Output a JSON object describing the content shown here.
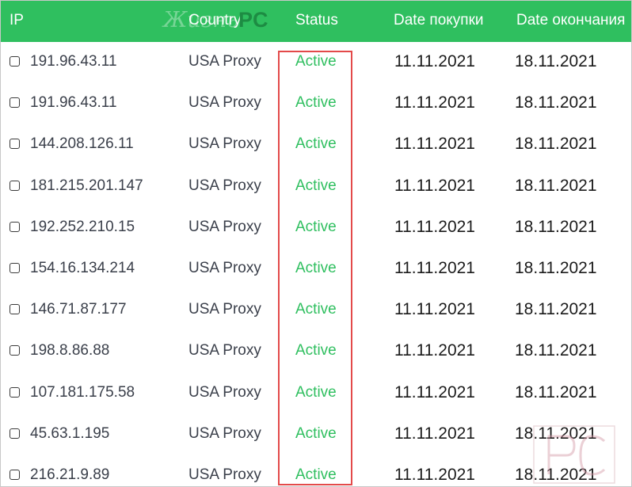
{
  "table": {
    "headers": {
      "ip": "IP",
      "country": "Country",
      "status": "Status",
      "date_buy": "Date покупки",
      "date_end": "Date окончания"
    },
    "rows": [
      {
        "ip": "191.96.43.11",
        "country": "USA Proxy",
        "status": "Active",
        "date_buy": "11.11.2021",
        "date_end": "18.11.2021"
      },
      {
        "ip": "191.96.43.11",
        "country": "USA Proxy",
        "status": "Active",
        "date_buy": "11.11.2021",
        "date_end": "18.11.2021"
      },
      {
        "ip": "144.208.126.11",
        "country": "USA Proxy",
        "status": "Active",
        "date_buy": "11.11.2021",
        "date_end": "18.11.2021"
      },
      {
        "ip": "181.215.201.147",
        "country": "USA Proxy",
        "status": "Active",
        "date_buy": "11.11.2021",
        "date_end": "18.11.2021"
      },
      {
        "ip": "192.252.210.15",
        "country": "USA Proxy",
        "status": "Active",
        "date_buy": "11.11.2021",
        "date_end": "18.11.2021"
      },
      {
        "ip": "154.16.134.214",
        "country": "USA Proxy",
        "status": "Active",
        "date_buy": "11.11.2021",
        "date_end": "18.11.2021"
      },
      {
        "ip": "146.71.87.177",
        "country": "USA Proxy",
        "status": "Active",
        "date_buy": "11.11.2021",
        "date_end": "18.11.2021"
      },
      {
        "ip": "198.8.86.88",
        "country": "USA Proxy",
        "status": "Active",
        "date_buy": "11.11.2021",
        "date_end": "18.11.2021"
      },
      {
        "ip": "107.181.175.58",
        "country": "USA Proxy",
        "status": "Active",
        "date_buy": "11.11.2021",
        "date_end": "18.11.2021"
      },
      {
        "ip": "45.63.1.195",
        "country": "USA Proxy",
        "status": "Active",
        "date_buy": "11.11.2021",
        "date_end": "18.11.2021"
      },
      {
        "ip": "216.21.9.89",
        "country": "USA Proxy",
        "status": "Active",
        "date_buy": "11.11.2021",
        "date_end": "18.11.2021"
      }
    ]
  },
  "watermark": {
    "script": "Жизнь",
    "pc": "PC"
  },
  "colors": {
    "header_bg": "#2fbf5f",
    "status_active": "#2fbf5f",
    "highlight": "#e34a4a"
  },
  "icons": {
    "checkbox": "checkbox-icon"
  }
}
